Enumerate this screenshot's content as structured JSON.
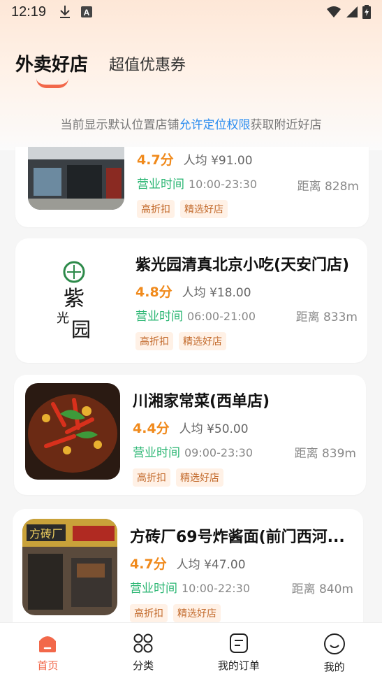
{
  "status_bar": {
    "time": "12:19",
    "icons": [
      "download-icon",
      "a-badge-icon",
      "wifi-icon",
      "signal-icon",
      "battery-icon"
    ]
  },
  "tabs": [
    {
      "label": "外卖好店",
      "active": true
    },
    {
      "label": "超值优惠券",
      "active": false
    }
  ],
  "notice": {
    "prefix": "当前显示默认位置店铺",
    "link": "允许定位权限",
    "suffix": "获取附近好店"
  },
  "shops": [
    {
      "name": "",
      "rating": "4.7分",
      "avg_price": "人均 ¥91.00",
      "hours_label": "营业时间",
      "hours": "10:00-23:30",
      "distance": "距离 828m",
      "tags": [
        "高折扣",
        "精选好店"
      ]
    },
    {
      "name": "紫光园清真北京小吃(天安门店)",
      "rating": "4.8分",
      "avg_price": "人均 ¥18.00",
      "hours_label": "营业时间",
      "hours": "06:00-21:00",
      "distance": "距离 833m",
      "tags": [
        "高折扣",
        "精选好店"
      ]
    },
    {
      "name": "川湘家常菜(西单店)",
      "rating": "4.4分",
      "avg_price": "人均 ¥50.00",
      "hours_label": "营业时间",
      "hours": "09:00-23:30",
      "distance": "距离 839m",
      "tags": [
        "高折扣",
        "精选好店"
      ]
    },
    {
      "name": "方砖厂69号炸酱面(前门西河...",
      "rating": "4.7分",
      "avg_price": "人均 ¥47.00",
      "hours_label": "营业时间",
      "hours": "10:00-22:30",
      "distance": "距离 840m",
      "tags": [
        "高折扣",
        "精选好店"
      ]
    }
  ],
  "bottom_nav": [
    {
      "label": "首页",
      "icon": "home-icon",
      "active": true
    },
    {
      "label": "分类",
      "icon": "category-grid-icon",
      "active": false
    },
    {
      "label": "我的订单",
      "icon": "order-icon",
      "active": false
    },
    {
      "label": "我的",
      "icon": "profile-icon",
      "active": false
    }
  ],
  "colors": {
    "accent": "#f2684a",
    "rating": "#f08a1c",
    "hours": "#2bb673",
    "link": "#2a8cf0",
    "tag_bg": "#fff1e6",
    "tag_text": "#c2692a"
  }
}
